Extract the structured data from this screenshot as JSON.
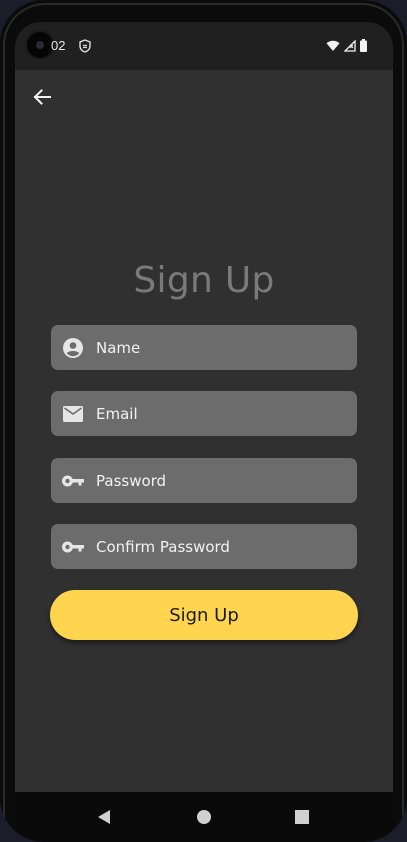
{
  "status_bar": {
    "time": "02",
    "notification_icon": "shield-icon",
    "icons": [
      "wifi-icon",
      "signal-icon",
      "battery-icon"
    ]
  },
  "header": {
    "back_icon": "arrow-left-icon"
  },
  "form": {
    "title": "Sign Up",
    "fields": [
      {
        "icon": "account-circle-icon",
        "placeholder": "Name",
        "value": ""
      },
      {
        "icon": "mail-icon",
        "placeholder": "Email",
        "value": ""
      },
      {
        "icon": "key-icon",
        "placeholder": "Password",
        "value": ""
      },
      {
        "icon": "key-icon",
        "placeholder": "Confirm Password",
        "value": ""
      }
    ],
    "submit_label": "Sign Up"
  },
  "nav_bar": {
    "icons": [
      "nav-back-icon",
      "nav-home-icon",
      "nav-recents-icon"
    ]
  },
  "colors": {
    "background": "#303030",
    "field_background": "#6c6c6c",
    "accent": "#ffd54f",
    "title": "#7a7a7a"
  }
}
